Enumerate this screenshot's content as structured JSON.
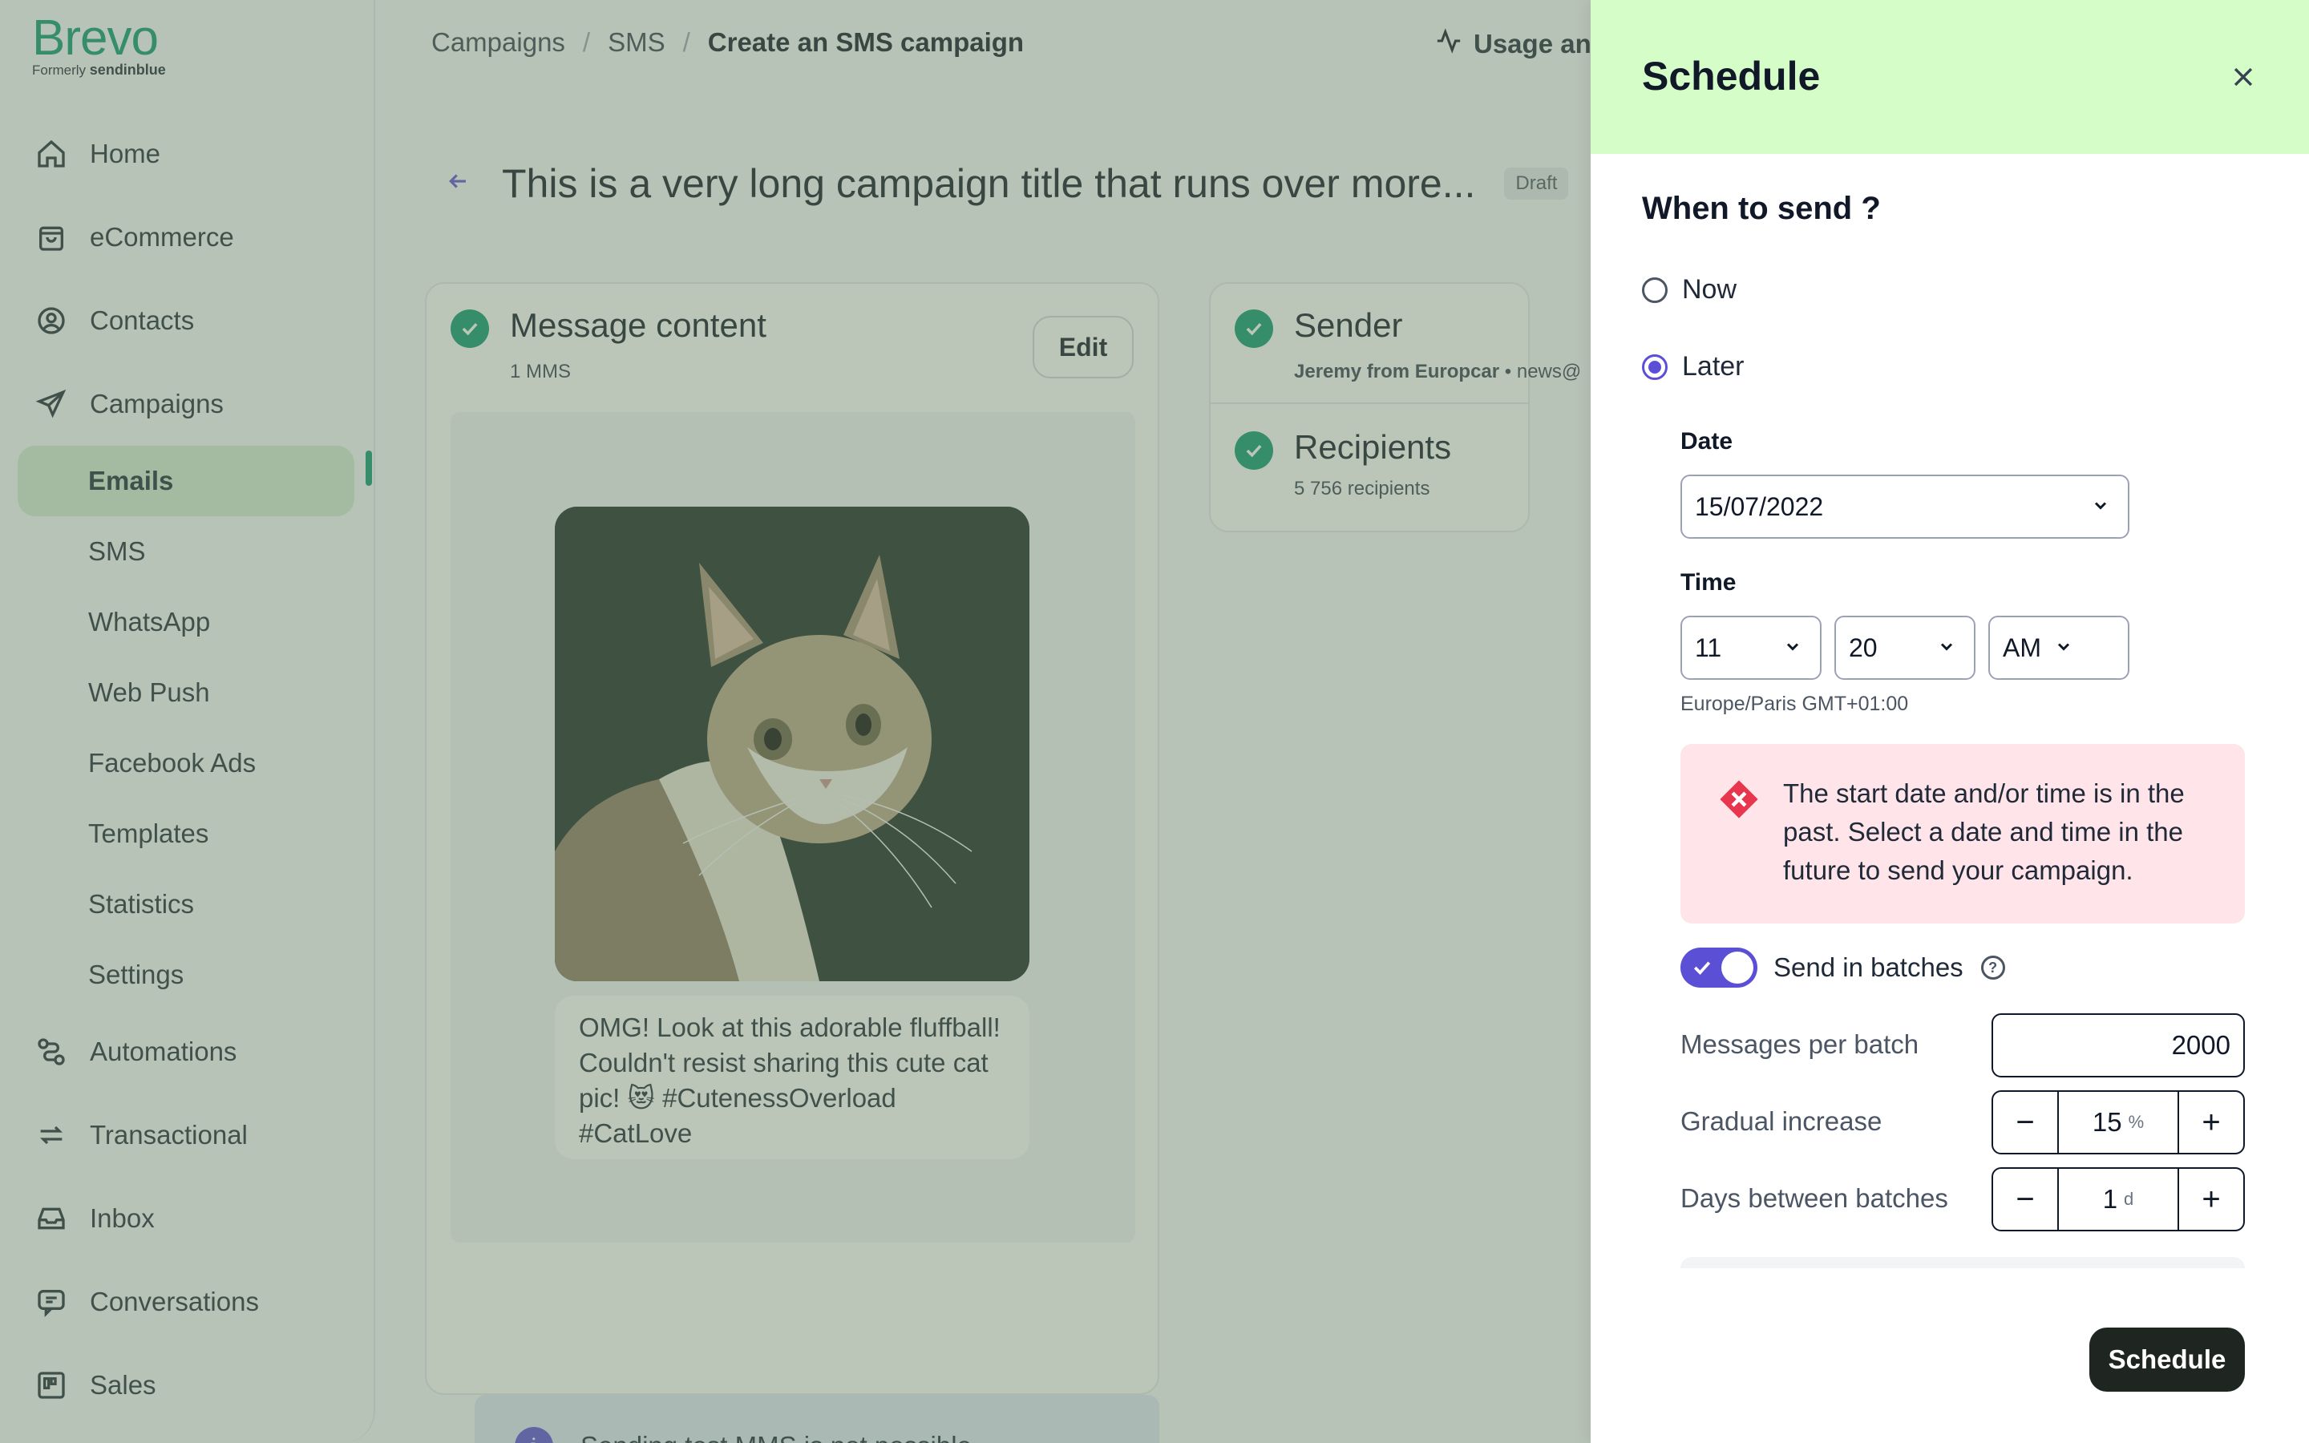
{
  "brand": {
    "name": "Brevo",
    "formerly": "Formerly",
    "former_name": "sendinblue"
  },
  "sidebar": {
    "items": [
      {
        "label": "Home",
        "icon": "home-icon"
      },
      {
        "label": "eCommerce",
        "icon": "shopping-bag-icon"
      },
      {
        "label": "Contacts",
        "icon": "contacts-icon"
      },
      {
        "label": "Campaigns",
        "icon": "send-icon"
      }
    ],
    "campaign_subitems": [
      "Emails",
      "SMS",
      "WhatsApp",
      "Web Push",
      "Facebook Ads",
      "Templates",
      "Statistics",
      "Settings"
    ],
    "active_subitem": "Emails",
    "bottom_items": [
      {
        "label": "Automations",
        "icon": "automations-icon"
      },
      {
        "label": "Transactional",
        "icon": "transactional-icon"
      },
      {
        "label": "Inbox",
        "icon": "inbox-icon"
      },
      {
        "label": "Conversations",
        "icon": "conversations-icon"
      },
      {
        "label": "Sales",
        "icon": "sales-icon"
      }
    ]
  },
  "breadcrumb": {
    "items": [
      "Campaigns",
      "SMS"
    ],
    "current": "Create an SMS campaign",
    "separator": "/"
  },
  "usage": {
    "label": "Usage an"
  },
  "page": {
    "title": "This is a very long campaign title that runs over more...",
    "status": "Draft"
  },
  "message_card": {
    "title": "Message content",
    "subtitle": "1 MMS",
    "edit_label": "Edit",
    "message_text": "OMG! Look at this adorable fluffball! Couldn't resist sharing this cute cat pic! 😻 #CutenessOverload #CatLove",
    "info": "Sending test MMS is not possible."
  },
  "sender_card": {
    "title": "Sender",
    "sender_name": "Jeremy from Europcar",
    "sender_email": "news@",
    "recipients_title": "Recipients",
    "recipients_count": "5 756 recipients"
  },
  "schedule": {
    "title": "Schedule",
    "when_label": "When to send ?",
    "options": [
      "Now",
      "Later"
    ],
    "selected": "Later",
    "date_label": "Date",
    "date_value": "15/07/2022",
    "time_label": "Time",
    "hour": "11",
    "minute": "20",
    "ampm": "AM",
    "timezone": "Europe/Paris GMT+01:00",
    "error": "The start date and/or time is in the past. Select a date and time in the future to send your campaign.",
    "batches_label": "Send in batches",
    "batches_enabled": true,
    "messages_per_batch_label": "Messages per batch",
    "messages_per_batch": "2000",
    "gradual_increase_label": "Gradual increase",
    "gradual_increase": "15",
    "gradual_unit": "%",
    "days_between_label": "Days between batches",
    "days_between": "1",
    "days_unit": "d",
    "submit_label": "Schedule"
  },
  "colors": {
    "brand_green": "#0b996e",
    "accent_purple": "#5b4fd6",
    "header_green": "#d4fdc8",
    "error_bg": "#ffe5e9",
    "error_red": "#e8364f"
  }
}
